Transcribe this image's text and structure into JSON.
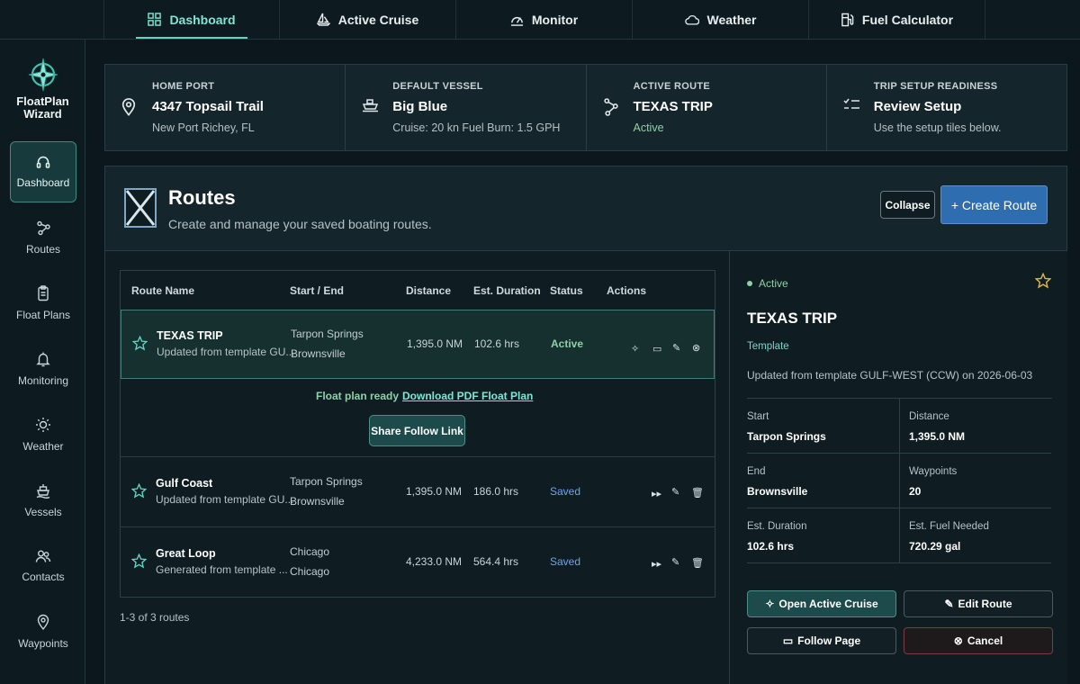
{
  "topnav": {
    "items": [
      {
        "label": "Dashboard",
        "icon": "grid-icon"
      },
      {
        "label": "Active Cruise",
        "icon": "sailboat-icon"
      },
      {
        "label": "Monitor",
        "icon": "gauge-icon"
      },
      {
        "label": "Weather",
        "icon": "cloud-icon"
      },
      {
        "label": "Fuel Calculator",
        "icon": "fuel-pump-icon"
      }
    ],
    "active": "Dashboard"
  },
  "sidebar": {
    "logo_text": "FloatPlan\nWizard",
    "items": [
      {
        "label": "Dashboard",
        "icon": "headset-icon"
      },
      {
        "label": "Routes",
        "icon": "route-icon"
      },
      {
        "label": "Float Plans",
        "icon": "clipboard-icon"
      },
      {
        "label": "Monitoring",
        "icon": "bell-icon"
      },
      {
        "label": "Weather",
        "icon": "sun-icon"
      },
      {
        "label": "Vessels",
        "icon": "ship-icon"
      },
      {
        "label": "Contacts",
        "icon": "people-icon"
      },
      {
        "label": "Waypoints",
        "icon": "map-pin-icon"
      }
    ]
  },
  "summary": {
    "home_port": {
      "label": "HOME PORT",
      "title": "4347 Topsail Trail",
      "sub": "New Port Richey, FL"
    },
    "default_vessel": {
      "label": "DEFAULT VESSEL",
      "title": "Big Blue",
      "sub": "Cruise: 20 kn Fuel Burn: 1.5 GPH"
    },
    "active_route": {
      "label": "ACTIVE ROUTE",
      "title": "TEXAS TRIP",
      "sub": "Active"
    },
    "readiness": {
      "label": "TRIP SETUP READINESS",
      "title": "Review Setup",
      "sub": "Use the setup tiles below."
    }
  },
  "routes_panel": {
    "title": "Routes",
    "subtitle": "Create and manage your saved boating routes.",
    "collapse_label": "Collapse",
    "create_label": "+ Create Route"
  },
  "table": {
    "headers": [
      "Route Name",
      "Start / End",
      "Distance",
      "Est. Duration",
      "Status",
      "Actions"
    ],
    "rows": [
      {
        "name": "TEXAS TRIP",
        "desc": "Updated from template GU...",
        "start": "Tarpon Springs",
        "end": "Brownsville",
        "distance": "1,395.0 NM",
        "duration": "102.6 hrs",
        "status": "Active"
      },
      {
        "name": "Gulf Coast",
        "desc": "Updated from template GU...",
        "start": "Tarpon Springs",
        "end": "Brownsville",
        "distance": "1,395.0 NM",
        "duration": "186.0 hrs",
        "status": "Saved"
      },
      {
        "name": "Great Loop",
        "desc": "Generated from template ...",
        "start": "Chicago",
        "end": "Chicago",
        "distance": "4,233.0 NM",
        "duration": "564.4 hrs",
        "status": "Saved"
      }
    ],
    "float_plan_ready": "Float plan ready",
    "download_link": "Download PDF Float Plan",
    "share_label": "Share Follow Link",
    "pager": "1-3 of 3 routes"
  },
  "detail": {
    "status": "Active",
    "title": "TEXAS TRIP",
    "template_label": "Template",
    "updated": "Updated from template GULF-WEST (CCW) on 2026-06-03",
    "fields": [
      {
        "label": "Start",
        "value": "Tarpon Springs"
      },
      {
        "label": "Distance",
        "value": "1,395.0 NM"
      },
      {
        "label": "End",
        "value": "Brownsville"
      },
      {
        "label": "Waypoints",
        "value": "20"
      },
      {
        "label": "Est. Duration",
        "value": "102.6 hrs"
      },
      {
        "label": "Est. Fuel Needed",
        "value": "720.29 gal"
      }
    ],
    "buttons": {
      "open_cruise": "Open Active Cruise",
      "edit_route": "Edit Route",
      "follow_page": "Follow Page",
      "cancel": "Cancel"
    }
  },
  "colors": {
    "accent": "#5ed6c4",
    "primary_button": "#2f6db1",
    "active_status": "#8fd0a6",
    "saved_status": "#6ea5e0",
    "star": "#e0b44a"
  }
}
